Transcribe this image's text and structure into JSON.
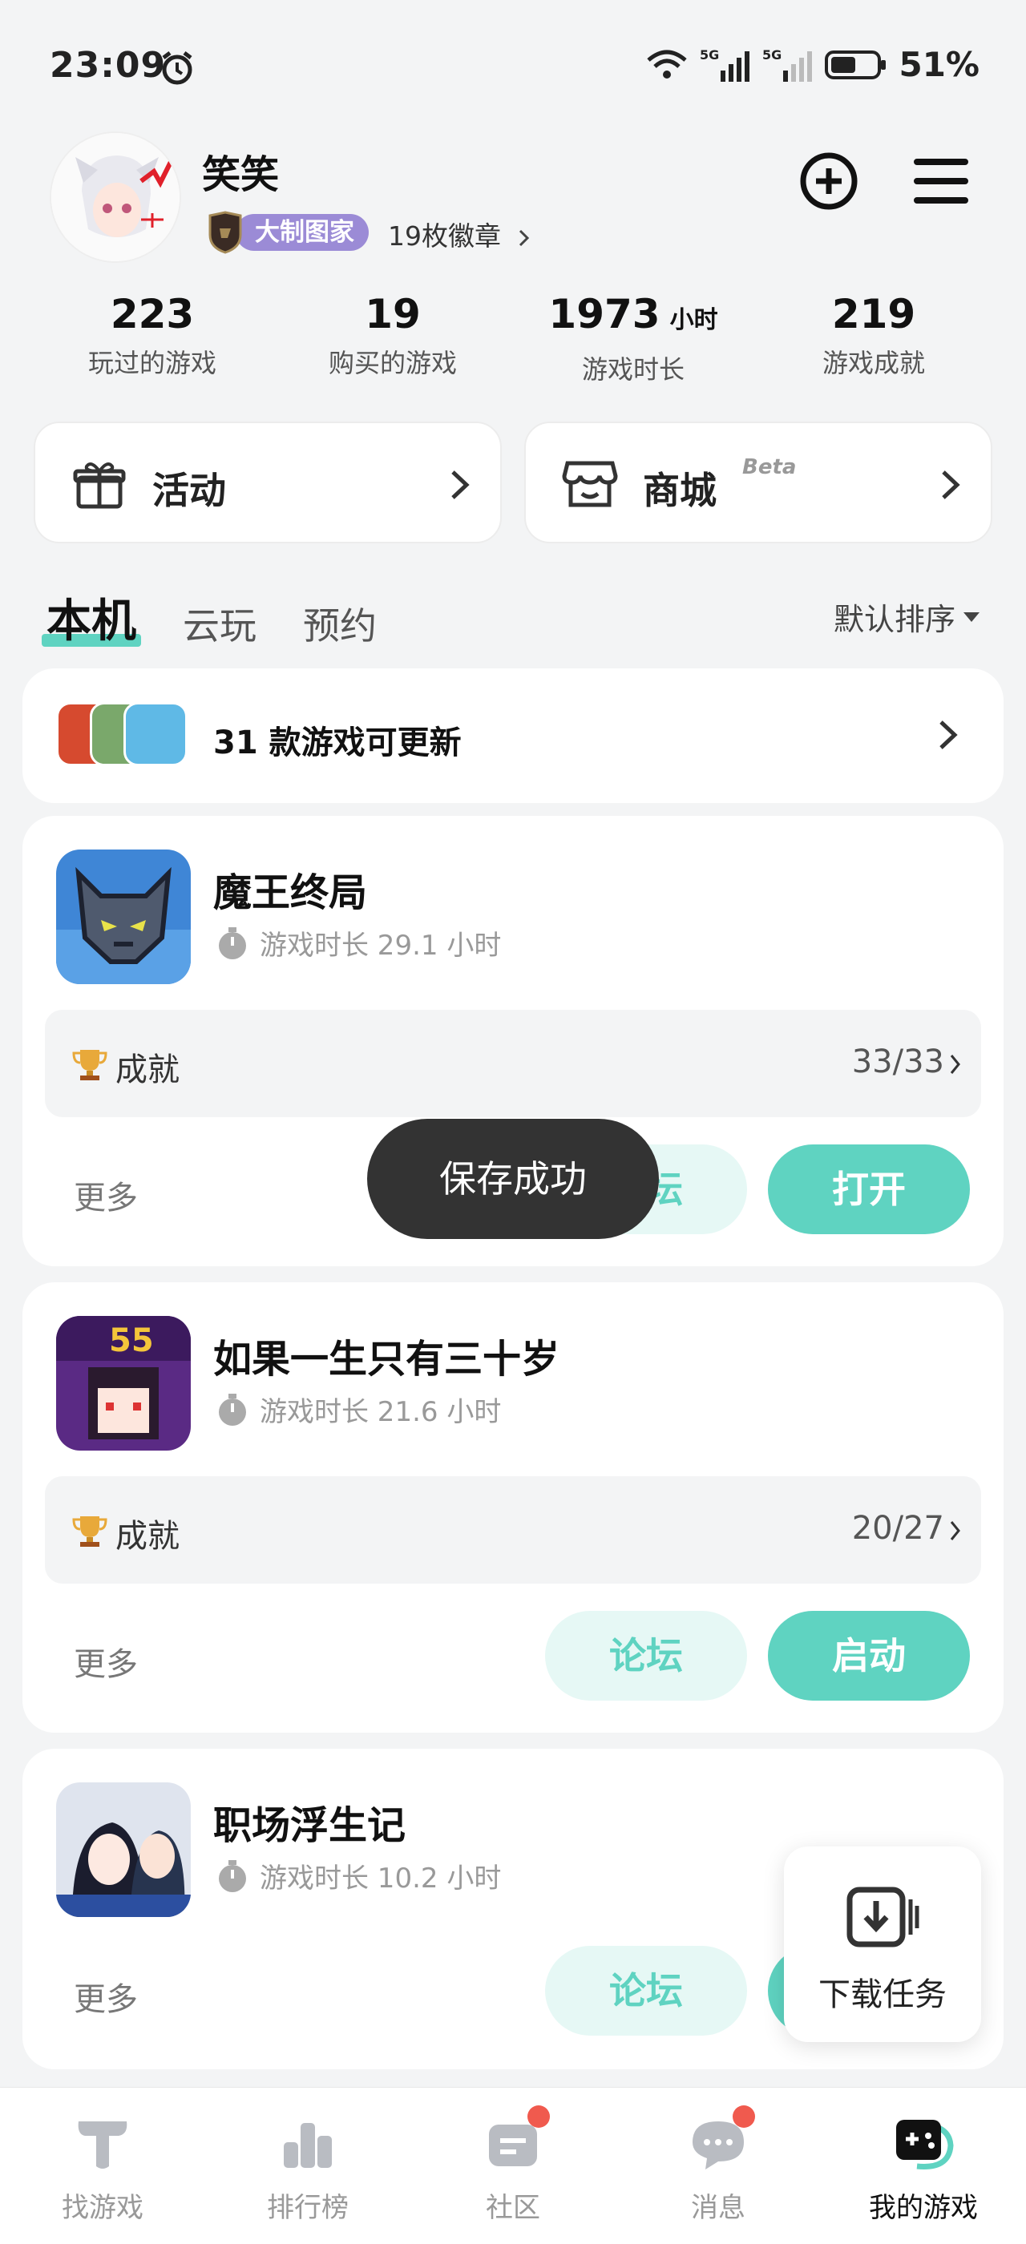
{
  "status_bar": {
    "time": "23:09",
    "battery": "51%",
    "network_1": "5G",
    "network_2": "5G"
  },
  "profile": {
    "username": "笑笑",
    "title_badge": "大制图家",
    "badges": "19枚徽章"
  },
  "stats": [
    {
      "value": "223",
      "unit": "",
      "label": "玩过的游戏"
    },
    {
      "value": "19",
      "unit": "",
      "label": "购买的游戏"
    },
    {
      "value": "1973",
      "unit": "小时",
      "label": "游戏时长"
    },
    {
      "value": "219",
      "unit": "",
      "label": "游戏成就"
    }
  ],
  "quick_links": {
    "activity": "活动",
    "store": "商城",
    "store_tag": "Beta"
  },
  "tabs": {
    "local": "本机",
    "cloud": "云玩",
    "reserve": "预约",
    "sort": "默认排序"
  },
  "update_banner": {
    "text": "31 款游戏可更新"
  },
  "games": [
    {
      "name": "魔王终局",
      "playtime": "游戏时长 29.1 小时",
      "achievement_label": "成就",
      "achievement": "33/33",
      "more": "更多",
      "forum": "论坛",
      "action": "打开"
    },
    {
      "name": "如果一生只有三十岁",
      "playtime": "游戏时长 21.6 小时",
      "achievement_label": "成就",
      "achievement": "20/27",
      "more": "更多",
      "forum": "论坛",
      "action": "启动"
    },
    {
      "name": "职场浮生记",
      "playtime": "游戏时长 10.2 小时",
      "more": "更多",
      "forum": "论坛"
    }
  ],
  "toast": "保存成功",
  "download_task": "下载任务",
  "bottom_nav": [
    {
      "label": "找游戏"
    },
    {
      "label": "排行榜"
    },
    {
      "label": "社区"
    },
    {
      "label": "消息"
    },
    {
      "label": "我的游戏"
    }
  ],
  "colors": {
    "accent": "#5fd3c1",
    "accent_light": "#e6f8f5",
    "badge_purple": "#9b8bd6",
    "notification_red": "#f05a4e"
  }
}
